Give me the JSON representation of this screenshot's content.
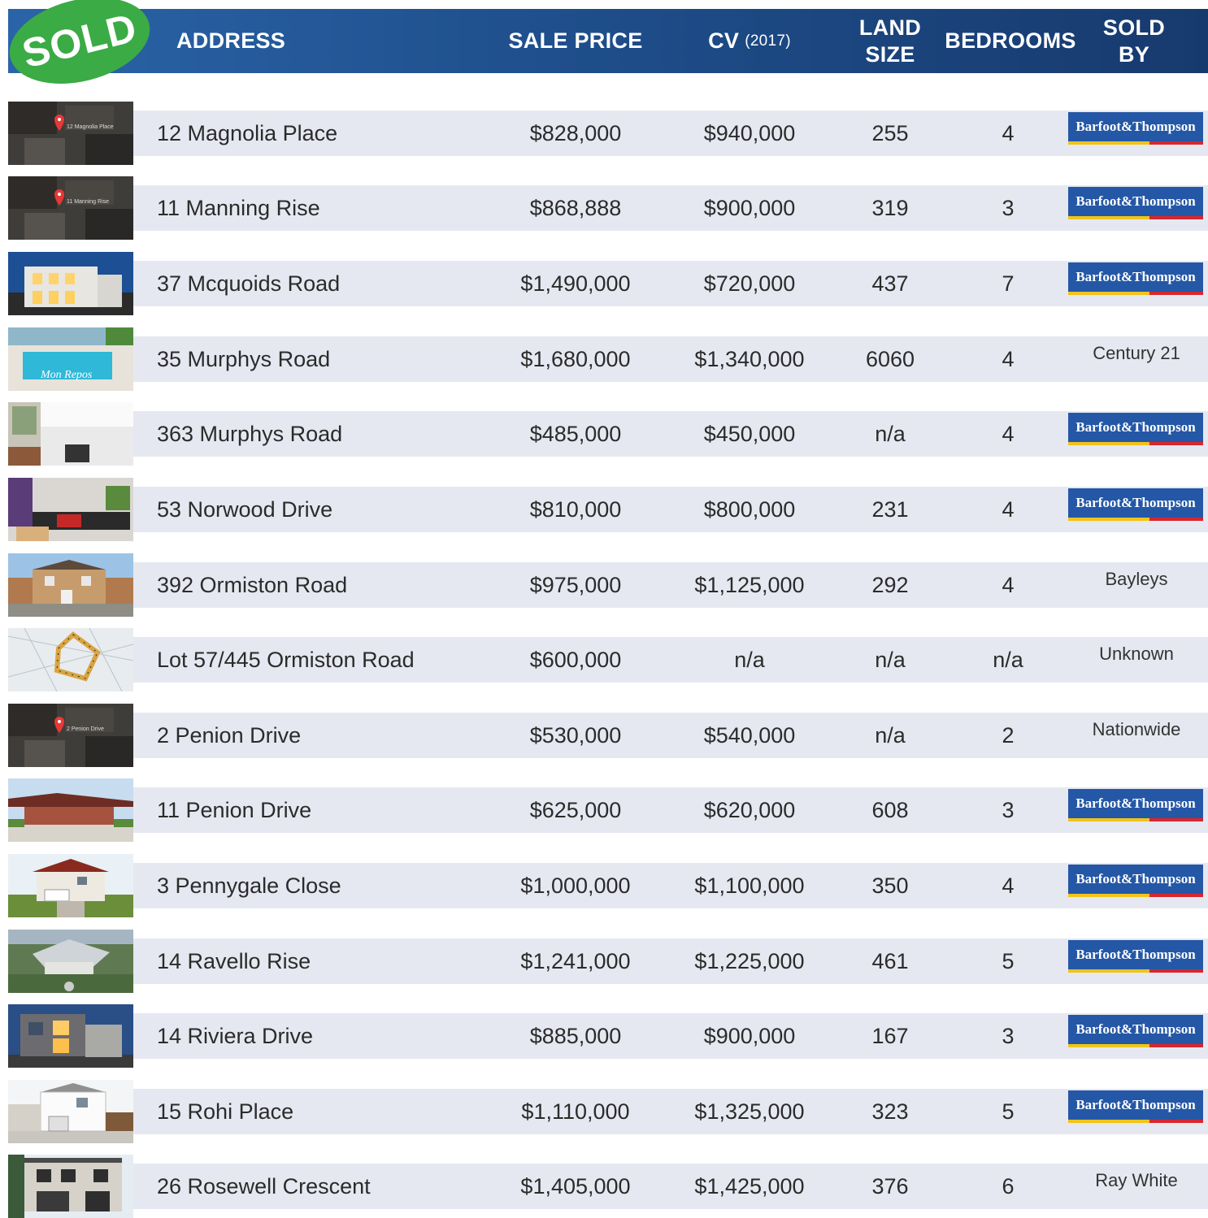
{
  "header": {
    "badge": "SOLD",
    "col_address": "ADDRESS",
    "col_sale_price": "SALE PRICE",
    "col_cv": "CV",
    "col_cv_year": "(2017)",
    "col_land_1": "LAND",
    "col_land_2": "SIZE",
    "col_bedrooms": "BEDROOMS",
    "col_sold_1": "SOLD",
    "col_sold_2": "BY"
  },
  "colors": {
    "header": "#1f4f8c",
    "badge": "#3bab45",
    "row_band": "#e6e8f1",
    "agency_logo": "#2457a6"
  },
  "rows": [
    {
      "address": "12 Magnolia Place",
      "sale_price": "$828,000",
      "cv": "$940,000",
      "land": "255",
      "bedrooms": "4",
      "agent": "Barfoot&Thompson",
      "logo": true,
      "thumb": "aerial-map",
      "thumb_label": "12 Magnolia Place"
    },
    {
      "address": "11 Manning Rise",
      "sale_price": "$868,888",
      "cv": "$900,000",
      "land": "319",
      "bedrooms": "3",
      "agent": "Barfoot&Thompson",
      "logo": true,
      "thumb": "aerial-map",
      "thumb_label": "11 Manning Rise"
    },
    {
      "address": "37 Mcquoids Road",
      "sale_price": "$1,490,000",
      "cv": "$720,000",
      "land": "437",
      "bedrooms": "7",
      "agent": "Barfoot&Thompson",
      "logo": true,
      "thumb": "house-dusk"
    },
    {
      "address": "35 Murphys Road",
      "sale_price": "$1,680,000",
      "cv": "$1,340,000",
      "land": "6060",
      "bedrooms": "4",
      "agent": "Century 21",
      "logo": false,
      "thumb": "pool",
      "thumb_label": "Mon Repos"
    },
    {
      "address": "363 Murphys Road",
      "sale_price": "$485,000",
      "cv": "$450,000",
      "land": "n/a",
      "bedrooms": "4",
      "agent": "Barfoot&Thompson",
      "logo": true,
      "thumb": "kitchen"
    },
    {
      "address": "53 Norwood Drive",
      "sale_price": "$810,000",
      "cv": "$800,000",
      "land": "231",
      "bedrooms": "4",
      "agent": "Barfoot&Thompson",
      "logo": true,
      "thumb": "living-room"
    },
    {
      "address": "392 Ormiston Road",
      "sale_price": "$975,000",
      "cv": "$1,125,000",
      "land": "292",
      "bedrooms": "4",
      "agent": "Bayleys",
      "logo": false,
      "thumb": "brick-house"
    },
    {
      "address": "Lot 57/445 Ormiston Road",
      "sale_price": "$600,000",
      "cv": "n/a",
      "land": "n/a",
      "bedrooms": "n/a",
      "agent": "Unknown",
      "logo": false,
      "thumb": "plans"
    },
    {
      "address": "2 Penion Drive",
      "sale_price": "$530,000",
      "cv": "$540,000",
      "land": "n/a",
      "bedrooms": "2",
      "agent": "Nationwide",
      "logo": false,
      "thumb": "aerial-map",
      "thumb_label": "2 Penion Drive"
    },
    {
      "address": "11 Penion Drive",
      "sale_price": "$625,000",
      "cv": "$620,000",
      "land": "608",
      "bedrooms": "3",
      "agent": "Barfoot&Thompson",
      "logo": true,
      "thumb": "carport-house"
    },
    {
      "address": "3 Pennygale Close",
      "sale_price": "$1,000,000",
      "cv": "$1,100,000",
      "land": "350",
      "bedrooms": "4",
      "agent": "Barfoot&Thompson",
      "logo": true,
      "thumb": "red-roof-house"
    },
    {
      "address": "14 Ravello Rise",
      "sale_price": "$1,241,000",
      "cv": "$1,225,000",
      "land": "461",
      "bedrooms": "5",
      "agent": "Barfoot&Thompson",
      "logo": true,
      "thumb": "grey-house-aerial"
    },
    {
      "address": "14 Riviera Drive",
      "sale_price": "$885,000",
      "cv": "$900,000",
      "land": "167",
      "bedrooms": "3",
      "agent": "Barfoot&Thompson",
      "logo": true,
      "thumb": "modern-house-dusk"
    },
    {
      "address": "15 Rohi Place",
      "sale_price": "$1,110,000",
      "cv": "$1,325,000",
      "land": "323",
      "bedrooms": "5",
      "agent": "Barfoot&Thompson",
      "logo": true,
      "thumb": "white-house"
    },
    {
      "address": "26 Rosewell Crescent",
      "sale_price": "$1,405,000",
      "cv": "$1,425,000",
      "land": "376",
      "bedrooms": "6",
      "agent": "Ray White",
      "logo": false,
      "thumb": "two-storey-house"
    }
  ]
}
